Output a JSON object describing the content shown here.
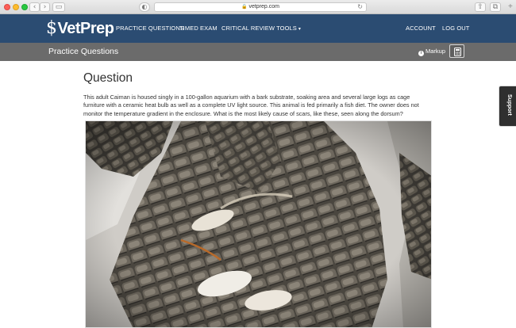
{
  "browser": {
    "url": "vetprep.com",
    "back": "‹",
    "forward": "›",
    "sidebar": "▭",
    "privacy": "◐",
    "reload": "↻",
    "share": "⇧",
    "tabs": "⧉",
    "new_tab": "+"
  },
  "nav": {
    "brand": "VetPrep",
    "brand_mark": "$",
    "links": [
      "PRACTICE QUESTIONS",
      "TIMED EXAM",
      "CRITICAL REVIEW TOOLS"
    ],
    "caret": "▾",
    "account": "ACCOUNT",
    "logout": "LOG OUT"
  },
  "subbar": {
    "title": "Practice Questions",
    "markup_label": "Markup",
    "info_glyph": "i"
  },
  "support": {
    "label": "Support"
  },
  "question": {
    "heading": "Question",
    "text": "This adult Caiman is housed singly in a 100-gallon aquarium with a bark substrate, soaking area and several large logs as cage furniture with a ceramic heat bulb as well as a complete UV light source. This animal is fed primarily a fish diet. The owner does not monitor the temperature gradient in the enclosure. What is the most likely cause of scars, like these, seen along the dorsum?"
  },
  "colors": {
    "nav_bg": "#2b4c72",
    "subbar_bg": "#6b6b6b",
    "support_bg": "#2f2f2f"
  },
  "icons": {
    "logo": "caduceus-s-icon",
    "info": "info-icon",
    "calculator": "calculator-icon"
  }
}
